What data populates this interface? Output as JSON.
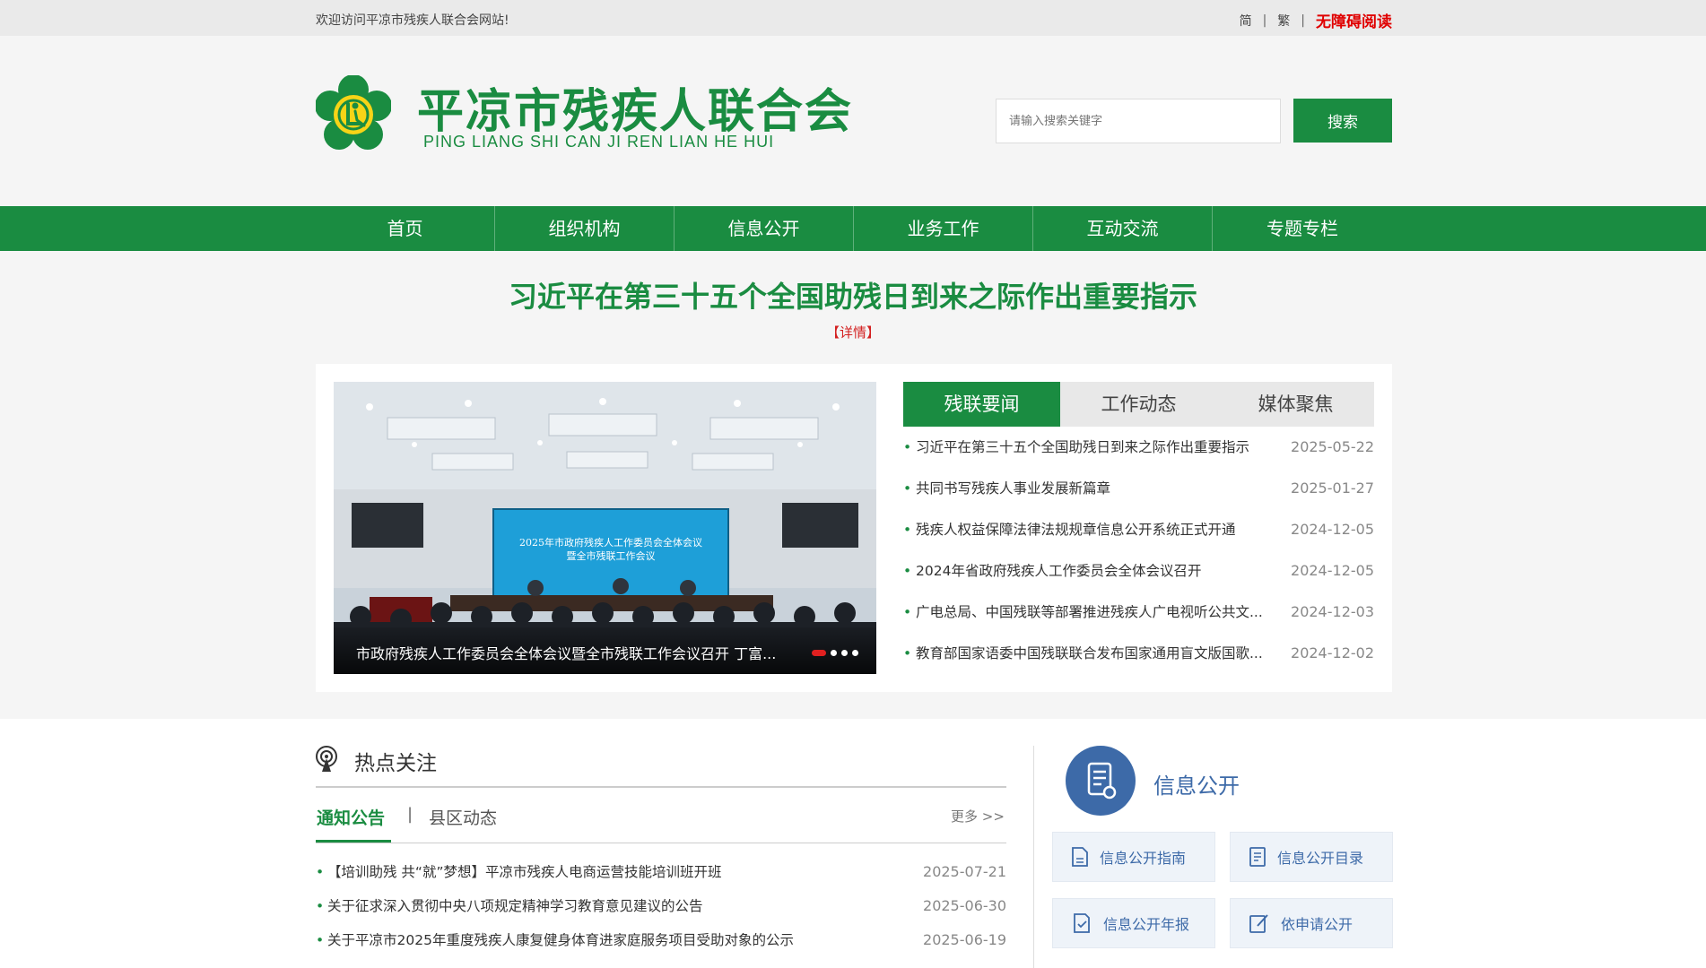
{
  "topbar": {
    "welcome": "欢迎访问平凉市残疾人联合会网站!",
    "simplified": "简",
    "separator": "|",
    "traditional": "繁",
    "barrier_free": "无障碍阅读"
  },
  "header": {
    "title_cn": "平凉市残疾人联合会",
    "title_en": "PING LIANG SHI CAN JI REN LIAN HE HUI",
    "search_placeholder": "请输入搜索关键字",
    "search_button": "搜索"
  },
  "nav": {
    "items": [
      "首页",
      "组织机构",
      "信息公开",
      "业务工作",
      "互动交流",
      "专题专栏"
    ]
  },
  "headline": {
    "title": "习近平在第三十五个全国助残日到来之际作出重要指示",
    "detail": "【详情】"
  },
  "carousel": {
    "screen_text_1": "2025年市政府残疾人工作委员会全体会议",
    "screen_text_2": "暨全市残联工作会议",
    "caption": "市政府残疾人工作委员会全体会议暨全市残联工作会议召开 丁富...",
    "slides": 4,
    "active_slide": 1
  },
  "news_tabs": [
    "残联要闻",
    "工作动态",
    "媒体聚焦"
  ],
  "news": [
    {
      "title": "习近平在第三十五个全国助残日到来之际作出重要指示",
      "date": "2025-05-22"
    },
    {
      "title": "共同书写残疾人事业发展新篇章",
      "date": "2025-01-27"
    },
    {
      "title": "残疾人权益保障法律法规规章信息公开系统正式开通",
      "date": "2024-12-05"
    },
    {
      "title": "2024年省政府残疾人工作委员会全体会议召开",
      "date": "2024-12-05"
    },
    {
      "title": "广电总局、中国残联等部署推进残疾人广电视听公共文...",
      "date": "2024-12-03"
    },
    {
      "title": "教育部国家语委中国残联联合发布国家通用盲文版国歌...",
      "date": "2024-12-02"
    }
  ],
  "hot": {
    "title": "热点关注",
    "tab_notice": "通知公告",
    "tab_separator": "|",
    "tab_county": "县区动态",
    "more": "更多 >>",
    "notices": [
      {
        "title": "【培训助残 共“就”梦想】平凉市残疾人电商运营技能培训班开班",
        "date": "2025-07-21"
      },
      {
        "title": "关于征求深入贯彻中央八项规定精神学习教育意见建议的公告",
        "date": "2025-06-30"
      },
      {
        "title": "关于平凉市2025年重度残疾人康复健身体育进家庭服务项目受助对象的公示",
        "date": "2025-06-19"
      }
    ]
  },
  "info": {
    "title": "信息公开",
    "buttons": [
      "信息公开指南",
      "信息公开目录",
      "信息公开年报",
      "依申请公开"
    ]
  },
  "colors": {
    "brand_green": "#1a8c41",
    "accent_red": "#e00000",
    "info_blue": "#3d6aa8"
  }
}
